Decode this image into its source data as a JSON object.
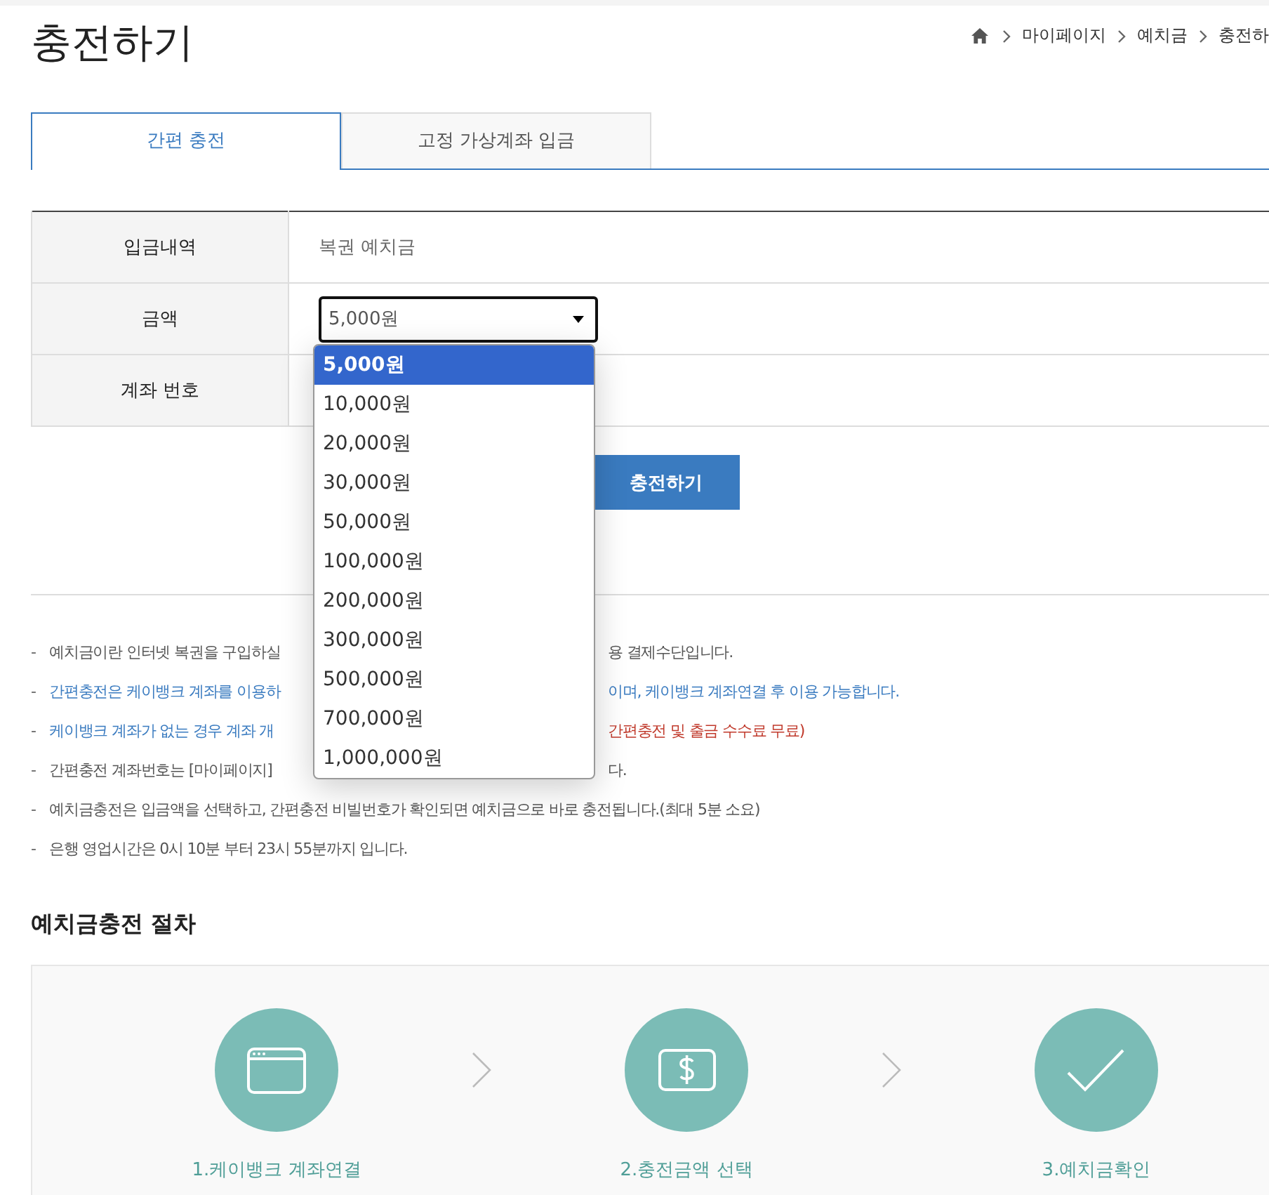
{
  "page_title": "충전하기",
  "breadcrumb": [
    "마이페이지",
    "예치금",
    "충전하"
  ],
  "tabs": [
    {
      "label": "간편 충전",
      "selected": true
    },
    {
      "label": "고정 가상계좌 입금",
      "selected": false
    }
  ],
  "form": {
    "rows": [
      {
        "label": "입금내역",
        "kind": "text",
        "value": "복권 예치금"
      },
      {
        "label": "금액",
        "kind": "select",
        "value": "5,000원"
      },
      {
        "label": "계좌 번호",
        "kind": "empty"
      }
    ]
  },
  "dropdown": {
    "options": [
      {
        "label": "5,000원",
        "selected": true
      },
      {
        "label": "10,000원",
        "selected": false
      },
      {
        "label": "20,000원",
        "selected": false
      },
      {
        "label": "30,000원",
        "selected": false
      },
      {
        "label": "50,000원",
        "selected": false
      },
      {
        "label": "100,000원",
        "selected": false
      },
      {
        "label": "200,000원",
        "selected": false
      },
      {
        "label": "300,000원",
        "selected": false
      },
      {
        "label": "500,000원",
        "selected": false
      },
      {
        "label": "700,000원",
        "selected": false
      },
      {
        "label": "1,000,000원",
        "selected": false
      }
    ]
  },
  "submit_button": "충전하기",
  "notes": [
    {
      "marker": "-",
      "before": {
        "text": "예치금이란 인터넷 복권을 구입하실",
        "color": "#555555"
      },
      "after": [
        {
          "text": "용 결제수단입니다.",
          "color": "#555555"
        }
      ]
    },
    {
      "marker": "-",
      "before": {
        "text": "간편충전은 케이뱅크 계좌를 이용하",
        "color": "#3a7bc0"
      },
      "after": [
        {
          "text": "이며, 케이뱅크 계좌연결 후 이용 가능합니다.",
          "color": "#3a7bc0"
        }
      ]
    },
    {
      "marker": "-",
      "before": {
        "text": "케이뱅크 계좌가 없는 경우 계좌 개",
        "color": "#3a7bc0"
      },
      "after": [
        {
          "text": "간편충전 및 출금 수수료 무료)",
          "color": "#c0392b"
        }
      ]
    },
    {
      "marker": "-",
      "before": {
        "text": "간편충전 계좌번호는 [마이페이지]",
        "color": "#555555"
      },
      "after": [
        {
          "text": "다.",
          "color": "#555555"
        }
      ]
    },
    {
      "marker": "-",
      "before": {
        "text": "예치금충전은 입금액을 선택하고, 간편충전 비빌번호가 확인되면 예치금으로 바로 충전됩니다.(최대 5분 소요)",
        "color": "#555555"
      }
    },
    {
      "marker": "-",
      "before": {
        "text": "은행 영업시간은 0시 10분 부터 23시 55분까지 입니다.",
        "color": "#555555"
      }
    }
  ],
  "procedure": {
    "title": "예치금충전 절차",
    "steps": [
      {
        "label": "1.케이뱅크 계좌연결",
        "kind": "window"
      },
      {
        "label": "2.충전금액 선택",
        "kind": "money"
      },
      {
        "label": "3.예치금확인",
        "kind": "check"
      }
    ]
  }
}
